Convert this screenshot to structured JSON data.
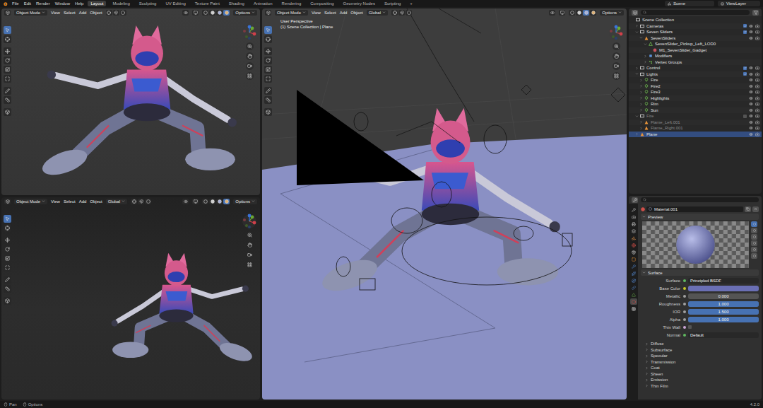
{
  "menubar": {
    "menus": [
      "File",
      "Edit",
      "Render",
      "Window",
      "Help"
    ],
    "workspaces": [
      {
        "label": "Layout",
        "selected": true
      },
      {
        "label": "Modeling",
        "selected": false
      },
      {
        "label": "Sculpting",
        "selected": false
      },
      {
        "label": "UV Editing",
        "selected": false
      },
      {
        "label": "Texture Paint",
        "selected": false
      },
      {
        "label": "Shading",
        "selected": false
      },
      {
        "label": "Animation",
        "selected": false
      },
      {
        "label": "Rendering",
        "selected": false
      },
      {
        "label": "Compositing",
        "selected": false
      },
      {
        "label": "Geometry Nodes",
        "selected": false
      },
      {
        "label": "Scripting",
        "selected": false
      }
    ],
    "add_workspace": "+",
    "scene": "Scene",
    "view_layer": "ViewLayer"
  },
  "viewports": [
    {
      "mode": "Object Mode",
      "menus": [
        "View",
        "Select",
        "Add",
        "Object"
      ],
      "options": "Options",
      "shading": [
        {
          "kind": "wireframe",
          "selected": false
        },
        {
          "kind": "solid",
          "selected": false
        },
        {
          "kind": "material",
          "selected": false
        },
        {
          "kind": "rendered",
          "selected": true
        }
      ],
      "tools": [
        {
          "kind": "select",
          "selected": true
        },
        {
          "kind": "cursor",
          "selected": false
        },
        {
          "kind": "move",
          "selected": false
        },
        {
          "kind": "rotate",
          "selected": false
        },
        {
          "kind": "scale",
          "selected": false
        },
        {
          "kind": "transform",
          "selected": false
        },
        {
          "kind": "annotate",
          "selected": false
        },
        {
          "kind": "measure",
          "selected": false
        },
        {
          "kind": "add",
          "selected": false
        }
      ]
    },
    {
      "mode": "Object Mode",
      "menus": [
        "View",
        "Select",
        "Add",
        "Object"
      ],
      "orientation": "Global",
      "options": "Options",
      "shading": [
        {
          "kind": "wireframe",
          "selected": false
        },
        {
          "kind": "solid",
          "selected": false
        },
        {
          "kind": "material",
          "selected": false
        },
        {
          "kind": "rendered",
          "selected": true
        }
      ],
      "tools": [
        {
          "kind": "select",
          "selected": true
        },
        {
          "kind": "cursor",
          "selected": false
        },
        {
          "kind": "move",
          "selected": false
        },
        {
          "kind": "rotate",
          "selected": false
        },
        {
          "kind": "scale",
          "selected": false
        },
        {
          "kind": "transform",
          "selected": false
        },
        {
          "kind": "annotate",
          "selected": false
        },
        {
          "kind": "measure",
          "selected": false
        },
        {
          "kind": "add",
          "selected": false
        }
      ]
    },
    {
      "mode": "Object Mode",
      "menus": [
        "View",
        "Select",
        "Add",
        "Object"
      ],
      "orientation": "Global",
      "options": "Options",
      "view_name": "User Perspective",
      "view_info": "(1) Scene Collection | Plane",
      "shading": [
        {
          "kind": "wireframe",
          "selected": false
        },
        {
          "kind": "solid",
          "selected": false
        },
        {
          "kind": "material",
          "selected": true
        },
        {
          "kind": "rendered",
          "selected": false
        }
      ],
      "tools": [
        {
          "kind": "select",
          "selected": true
        },
        {
          "kind": "cursor",
          "selected": false
        },
        {
          "kind": "move",
          "selected": false
        },
        {
          "kind": "rotate",
          "selected": false
        },
        {
          "kind": "scale",
          "selected": false
        },
        {
          "kind": "transform",
          "selected": false
        },
        {
          "kind": "annotate",
          "selected": false
        },
        {
          "kind": "measure",
          "selected": false
        },
        {
          "kind": "add",
          "selected": false
        }
      ]
    }
  ],
  "outliner": {
    "items": [
      {
        "label": "Scene Collection",
        "depth": 0,
        "kind": "scene",
        "expandable": false,
        "expanded": true,
        "selected": false,
        "greyed": false
      },
      {
        "label": "Cameras",
        "depth": 1,
        "kind": "collection",
        "expandable": true,
        "expanded": false,
        "selected": false,
        "greyed": false,
        "checked": true
      },
      {
        "label": "Seven Sliders",
        "depth": 1,
        "kind": "collection",
        "expandable": true,
        "expanded": true,
        "selected": false,
        "greyed": false,
        "checked": true
      },
      {
        "label": "SevenSliders",
        "depth": 2,
        "kind": "object",
        "expandable": true,
        "expanded": true,
        "selected": false,
        "greyed": false
      },
      {
        "label": "SevenSlider_Pickup_Left_LOD0",
        "depth": 3,
        "kind": "mesh",
        "expandable": true,
        "expanded": true,
        "selected": false,
        "greyed": false
      },
      {
        "label": "M1_SevenSlider_Gadget",
        "depth": 4,
        "kind": "material",
        "expandable": false,
        "expanded": false,
        "selected": false,
        "greyed": false
      },
      {
        "label": "Modifiers",
        "depth": 3,
        "kind": "modifier",
        "expandable": true,
        "expanded": false,
        "selected": false,
        "greyed": false
      },
      {
        "label": "Vertex Groups",
        "depth": 3,
        "kind": "vgroup",
        "expandable": true,
        "expanded": false,
        "selected": false,
        "greyed": false
      },
      {
        "label": "Control",
        "depth": 1,
        "kind": "collection",
        "expandable": true,
        "expanded": false,
        "selected": false,
        "greyed": false,
        "checked": true
      },
      {
        "label": "Lights",
        "depth": 1,
        "kind": "collection",
        "expandable": true,
        "expanded": true,
        "selected": false,
        "greyed": false,
        "checked": true
      },
      {
        "label": "Fire",
        "depth": 2,
        "kind": "light",
        "expandable": true,
        "expanded": false,
        "selected": false,
        "greyed": false
      },
      {
        "label": "Fire2",
        "depth": 2,
        "kind": "light",
        "expandable": true,
        "expanded": false,
        "selected": false,
        "greyed": false
      },
      {
        "label": "Fire3",
        "depth": 2,
        "kind": "light",
        "expandable": true,
        "expanded": false,
        "selected": false,
        "greyed": false
      },
      {
        "label": "Highlights",
        "depth": 2,
        "kind": "light",
        "expandable": true,
        "expanded": false,
        "selected": false,
        "greyed": false
      },
      {
        "label": "Rim",
        "depth": 2,
        "kind": "light",
        "expandable": true,
        "expanded": false,
        "selected": false,
        "greyed": false
      },
      {
        "label": "Sun",
        "depth": 2,
        "kind": "light",
        "expandable": true,
        "expanded": false,
        "selected": false,
        "greyed": false
      },
      {
        "label": "Fire",
        "depth": 1,
        "kind": "collection",
        "expandable": true,
        "expanded": true,
        "selected": false,
        "greyed": true,
        "checked": false
      },
      {
        "label": "Flame_Left.001",
        "depth": 2,
        "kind": "object",
        "expandable": true,
        "expanded": false,
        "selected": false,
        "greyed": true
      },
      {
        "label": "Flame_Right.001",
        "depth": 2,
        "kind": "object",
        "expandable": true,
        "expanded": false,
        "selected": false,
        "greyed": true
      },
      {
        "label": "Plane",
        "depth": 1,
        "kind": "object",
        "expandable": true,
        "expanded": false,
        "selected": true,
        "greyed": false
      }
    ]
  },
  "properties": {
    "tabs": [
      {
        "kind": "tool",
        "selected": false
      },
      {
        "kind": "render",
        "selected": false
      },
      {
        "kind": "output",
        "selected": false
      },
      {
        "kind": "view_layer",
        "selected": false
      },
      {
        "kind": "scene",
        "selected": false
      },
      {
        "kind": "world",
        "selected": false
      },
      {
        "kind": "collection",
        "selected": false
      },
      {
        "kind": "object",
        "selected": false
      },
      {
        "kind": "modifiers",
        "selected": false
      },
      {
        "kind": "particles",
        "selected": false
      },
      {
        "kind": "physics",
        "selected": false
      },
      {
        "kind": "constraints",
        "selected": false
      },
      {
        "kind": "data",
        "selected": false
      },
      {
        "kind": "material",
        "selected": true
      },
      {
        "kind": "texture",
        "selected": false
      }
    ],
    "material": "Material.001",
    "preview": {
      "label": "Preview",
      "expanded": true
    },
    "surface": {
      "label": "Surface",
      "expanded": true
    },
    "fields": [
      {
        "label": "Surface",
        "kind": "dropdown",
        "value": "Principled BSDF"
      },
      {
        "label": "Base Color",
        "kind": "color",
        "color": "#6a6fb4"
      },
      {
        "label": "Metallic",
        "kind": "slider",
        "value": "0.000",
        "level": 0
      },
      {
        "label": "Roughness",
        "kind": "slider",
        "value": "1.000",
        "level": 1
      },
      {
        "label": "IOR",
        "kind": "slider",
        "value": "1.500",
        "level": 1
      },
      {
        "label": "Alpha",
        "kind": "slider",
        "value": "1.000",
        "level": 1
      },
      {
        "label": "Thin Wall",
        "kind": "checkbox",
        "checked": false
      },
      {
        "label": "Normal",
        "kind": "dropdown",
        "value": "Default"
      }
    ],
    "subpanels": [
      {
        "label": "Diffuse",
        "expanded": false
      },
      {
        "label": "Subsurface",
        "expanded": false
      },
      {
        "label": "Specular",
        "expanded": false
      },
      {
        "label": "Transmission",
        "expanded": false
      },
      {
        "label": "Coat",
        "expanded": false
      },
      {
        "label": "Sheen",
        "expanded": false
      },
      {
        "label": "Emission",
        "expanded": false
      },
      {
        "label": "Thin Film",
        "expanded": false
      }
    ]
  },
  "status_bar": {
    "items": [
      {
        "label": "Pan"
      },
      {
        "label": "Options"
      }
    ],
    "version": "4.2.0"
  }
}
